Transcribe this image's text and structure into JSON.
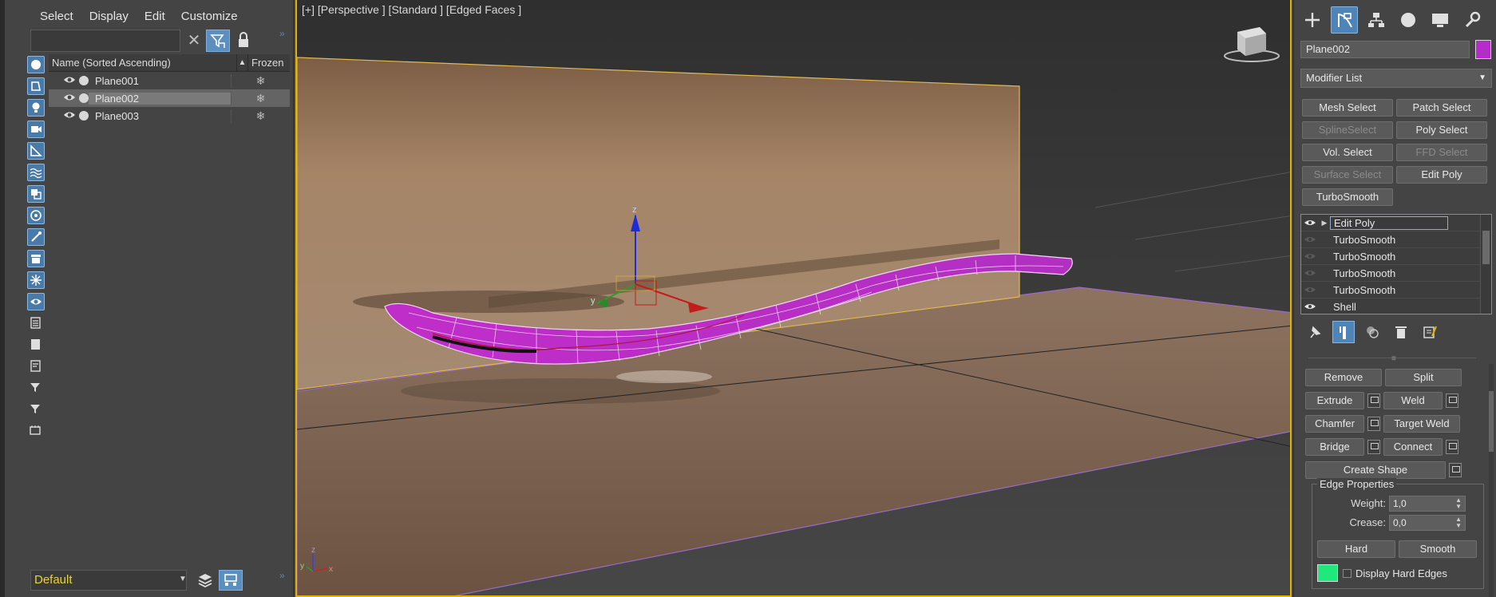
{
  "menu": [
    "Select",
    "Display",
    "Edit",
    "Customize"
  ],
  "scene_explorer": {
    "columns": {
      "name": "Name (Sorted Ascending)",
      "sort_indicator": "▲",
      "frozen": "Frozen"
    },
    "objects": [
      {
        "name": "Plane001",
        "selected": false
      },
      {
        "name": "Plane002",
        "selected": true
      },
      {
        "name": "Plane003",
        "selected": false
      }
    ],
    "layer": "Default",
    "search_value": ""
  },
  "viewport": {
    "label": "[+] [Perspective ] [Standard ] [Edged Faces ]",
    "gizmo_axes": {
      "x": "x",
      "y": "y",
      "z": "z"
    },
    "corner_axes": {
      "x": "x",
      "y": "y",
      "z": "z"
    }
  },
  "command_panel": {
    "object_name": "Plane002",
    "object_color": "#b42dc8",
    "modifier_list": "Modifier List",
    "modifier_buttons": [
      {
        "label": "Mesh Select",
        "enabled": true
      },
      {
        "label": "Patch Select",
        "enabled": true
      },
      {
        "label": "SplineSelect",
        "enabled": false
      },
      {
        "label": "Poly Select",
        "enabled": true
      },
      {
        "label": "Vol. Select",
        "enabled": true
      },
      {
        "label": "FFD Select",
        "enabled": false
      },
      {
        "label": "Surface Select",
        "enabled": false
      },
      {
        "label": "Edit Poly",
        "enabled": true
      },
      {
        "label": "TurboSmooth",
        "enabled": true
      }
    ],
    "stack": [
      {
        "label": "Edit Poly",
        "active": true,
        "eye": "visible"
      },
      {
        "label": "TurboSmooth",
        "active": false,
        "eye": "hidden"
      },
      {
        "label": "TurboSmooth",
        "active": false,
        "eye": "hidden"
      },
      {
        "label": "TurboSmooth",
        "active": false,
        "eye": "hidden"
      },
      {
        "label": "TurboSmooth",
        "active": false,
        "eye": "hidden"
      },
      {
        "label": "Shell",
        "active": false,
        "eye": "visible"
      }
    ],
    "edit_edges": {
      "remove": "Remove",
      "split": "Split",
      "extrude": "Extrude",
      "weld": "Weld",
      "chamfer": "Chamfer",
      "target_weld": "Target Weld",
      "bridge": "Bridge",
      "connect": "Connect",
      "create_shape": "Create Shape"
    },
    "edge_properties": {
      "title": "Edge Properties",
      "weight_label": "Weight:",
      "weight_value": "1,0",
      "crease_label": "Crease:",
      "crease_value": "0,0",
      "hard": "Hard",
      "smooth": "Smooth",
      "display_hard_edges": "Display Hard Edges",
      "hard_edge_color": "#1fe97a"
    }
  },
  "colors": {
    "accent": "#4f84b8",
    "viewport_border": "#e0b400",
    "selection": "#b42dc8"
  }
}
